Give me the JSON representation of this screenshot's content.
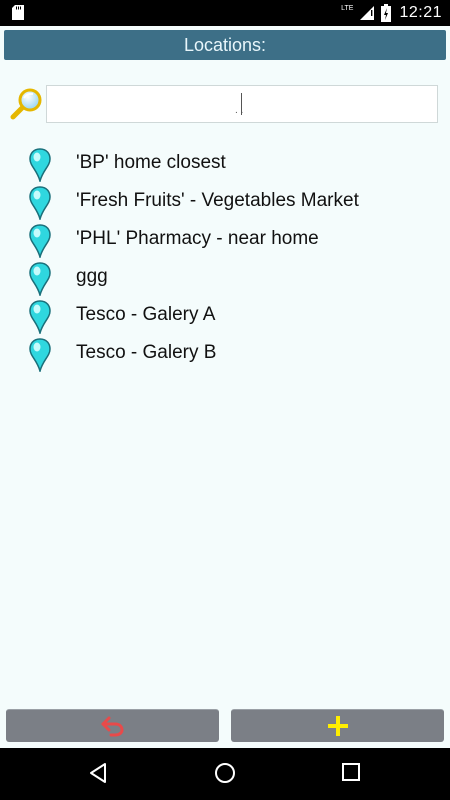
{
  "status_bar": {
    "network": "LTE",
    "time": "12:21",
    "icons": [
      "sd-card-icon",
      "signal-icon",
      "battery-icon"
    ]
  },
  "header": {
    "title": "Locations:"
  },
  "search": {
    "value": "",
    "placeholder": ""
  },
  "locations": [
    {
      "label": "'BP' home closest"
    },
    {
      "label": "'Fresh Fruits' - Vegetables Market"
    },
    {
      "label": "'PHL' Pharmacy - near home"
    },
    {
      "label": "ggg"
    },
    {
      "label": "Tesco - Galery A"
    },
    {
      "label": "Tesco - Galery B"
    }
  ],
  "toolbar": {
    "back_icon": "undo-arrow-icon",
    "add_icon": "plus-icon",
    "colors": {
      "back": "#e84a4a",
      "add": "#ffee00",
      "button_bg": "#7b7f86"
    }
  },
  "nav_bar": {
    "icons": [
      "back-triangle-icon",
      "home-circle-icon",
      "recents-square-icon"
    ]
  },
  "colors": {
    "title_bg": "#3d6f87",
    "page_bg": "#f4fcfc",
    "pin": "#2fd7df"
  }
}
